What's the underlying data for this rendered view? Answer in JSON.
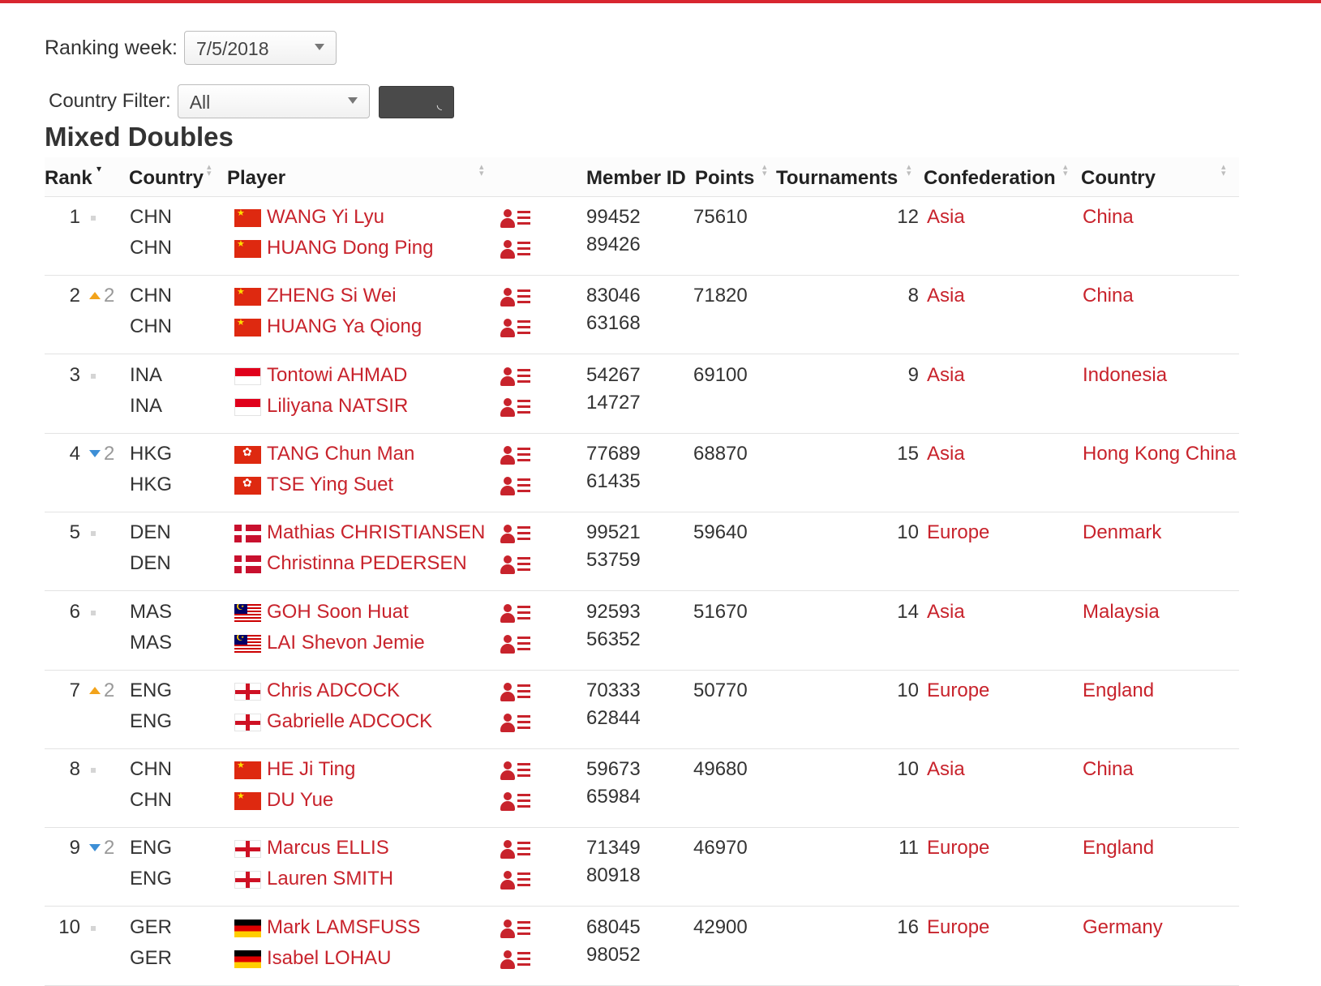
{
  "filters": {
    "ranking_week_label": "Ranking week:",
    "ranking_week_value": "7/5/2018",
    "country_filter_label": "Country Filter:",
    "country_filter_value": "All"
  },
  "title": "Mixed Doubles",
  "columns": {
    "rank": "Rank",
    "country": "Country",
    "player": "Player",
    "member_id": "Member ID",
    "points": "Points",
    "tournaments": "Tournaments",
    "confederation": "Confederation",
    "country_name": "Country"
  },
  "colors": {
    "accent": "#d8262f",
    "link": "#c8232c",
    "move_up": "#f2a31b",
    "move_down": "#3d8fd6"
  },
  "rows": [
    {
      "rank": "1",
      "move": "same",
      "move_amount": "",
      "codes": [
        "CHN",
        "CHN"
      ],
      "flags": [
        "chn",
        "chn"
      ],
      "players": [
        "WANG Yi Lyu",
        "HUANG Dong Ping"
      ],
      "member_ids": [
        "99452",
        "89426"
      ],
      "points": "75610",
      "tournaments": "12",
      "confederation": "Asia",
      "country": "China"
    },
    {
      "rank": "2",
      "move": "up",
      "move_amount": "2",
      "codes": [
        "CHN",
        "CHN"
      ],
      "flags": [
        "chn",
        "chn"
      ],
      "players": [
        "ZHENG Si Wei",
        "HUANG Ya Qiong"
      ],
      "member_ids": [
        "83046",
        "63168"
      ],
      "points": "71820",
      "tournaments": "8",
      "confederation": "Asia",
      "country": "China"
    },
    {
      "rank": "3",
      "move": "same",
      "move_amount": "",
      "codes": [
        "INA",
        "INA"
      ],
      "flags": [
        "ina",
        "ina"
      ],
      "players": [
        "Tontowi AHMAD",
        "Liliyana NATSIR"
      ],
      "member_ids": [
        "54267",
        "14727"
      ],
      "points": "69100",
      "tournaments": "9",
      "confederation": "Asia",
      "country": "Indonesia"
    },
    {
      "rank": "4",
      "move": "down",
      "move_amount": "2",
      "codes": [
        "HKG",
        "HKG"
      ],
      "flags": [
        "hkg",
        "hkg"
      ],
      "players": [
        "TANG Chun Man",
        "TSE Ying Suet"
      ],
      "member_ids": [
        "77689",
        "61435"
      ],
      "points": "68870",
      "tournaments": "15",
      "confederation": "Asia",
      "country": "Hong Kong China"
    },
    {
      "rank": "5",
      "move": "same",
      "move_amount": "",
      "codes": [
        "DEN",
        "DEN"
      ],
      "flags": [
        "den",
        "den"
      ],
      "players": [
        "Mathias CHRISTIANSEN",
        "Christinna PEDERSEN"
      ],
      "member_ids": [
        "99521",
        "53759"
      ],
      "points": "59640",
      "tournaments": "10",
      "confederation": "Europe",
      "country": "Denmark"
    },
    {
      "rank": "6",
      "move": "same",
      "move_amount": "",
      "codes": [
        "MAS",
        "MAS"
      ],
      "flags": [
        "mas",
        "mas"
      ],
      "players": [
        "GOH Soon Huat",
        "LAI Shevon Jemie"
      ],
      "member_ids": [
        "92593",
        "56352"
      ],
      "points": "51670",
      "tournaments": "14",
      "confederation": "Asia",
      "country": "Malaysia"
    },
    {
      "rank": "7",
      "move": "up",
      "move_amount": "2",
      "codes": [
        "ENG",
        "ENG"
      ],
      "flags": [
        "eng",
        "eng"
      ],
      "players": [
        "Chris ADCOCK",
        "Gabrielle ADCOCK"
      ],
      "member_ids": [
        "70333",
        "62844"
      ],
      "points": "50770",
      "tournaments": "10",
      "confederation": "Europe",
      "country": "England"
    },
    {
      "rank": "8",
      "move": "same",
      "move_amount": "",
      "codes": [
        "CHN",
        "CHN"
      ],
      "flags": [
        "chn",
        "chn"
      ],
      "players": [
        "HE Ji Ting",
        "DU Yue"
      ],
      "member_ids": [
        "59673",
        "65984"
      ],
      "points": "49680",
      "tournaments": "10",
      "confederation": "Asia",
      "country": "China"
    },
    {
      "rank": "9",
      "move": "down",
      "move_amount": "2",
      "codes": [
        "ENG",
        "ENG"
      ],
      "flags": [
        "eng",
        "eng"
      ],
      "players": [
        "Marcus ELLIS",
        "Lauren SMITH"
      ],
      "member_ids": [
        "71349",
        "80918"
      ],
      "points": "46970",
      "tournaments": "11",
      "confederation": "Europe",
      "country": "England"
    },
    {
      "rank": "10",
      "move": "same",
      "move_amount": "",
      "codes": [
        "GER",
        "GER"
      ],
      "flags": [
        "ger",
        "ger"
      ],
      "players": [
        "Mark LAMSFUSS",
        "Isabel LOHAU"
      ],
      "member_ids": [
        "68045",
        "98052"
      ],
      "points": "42900",
      "tournaments": "16",
      "confederation": "Europe",
      "country": "Germany"
    }
  ]
}
